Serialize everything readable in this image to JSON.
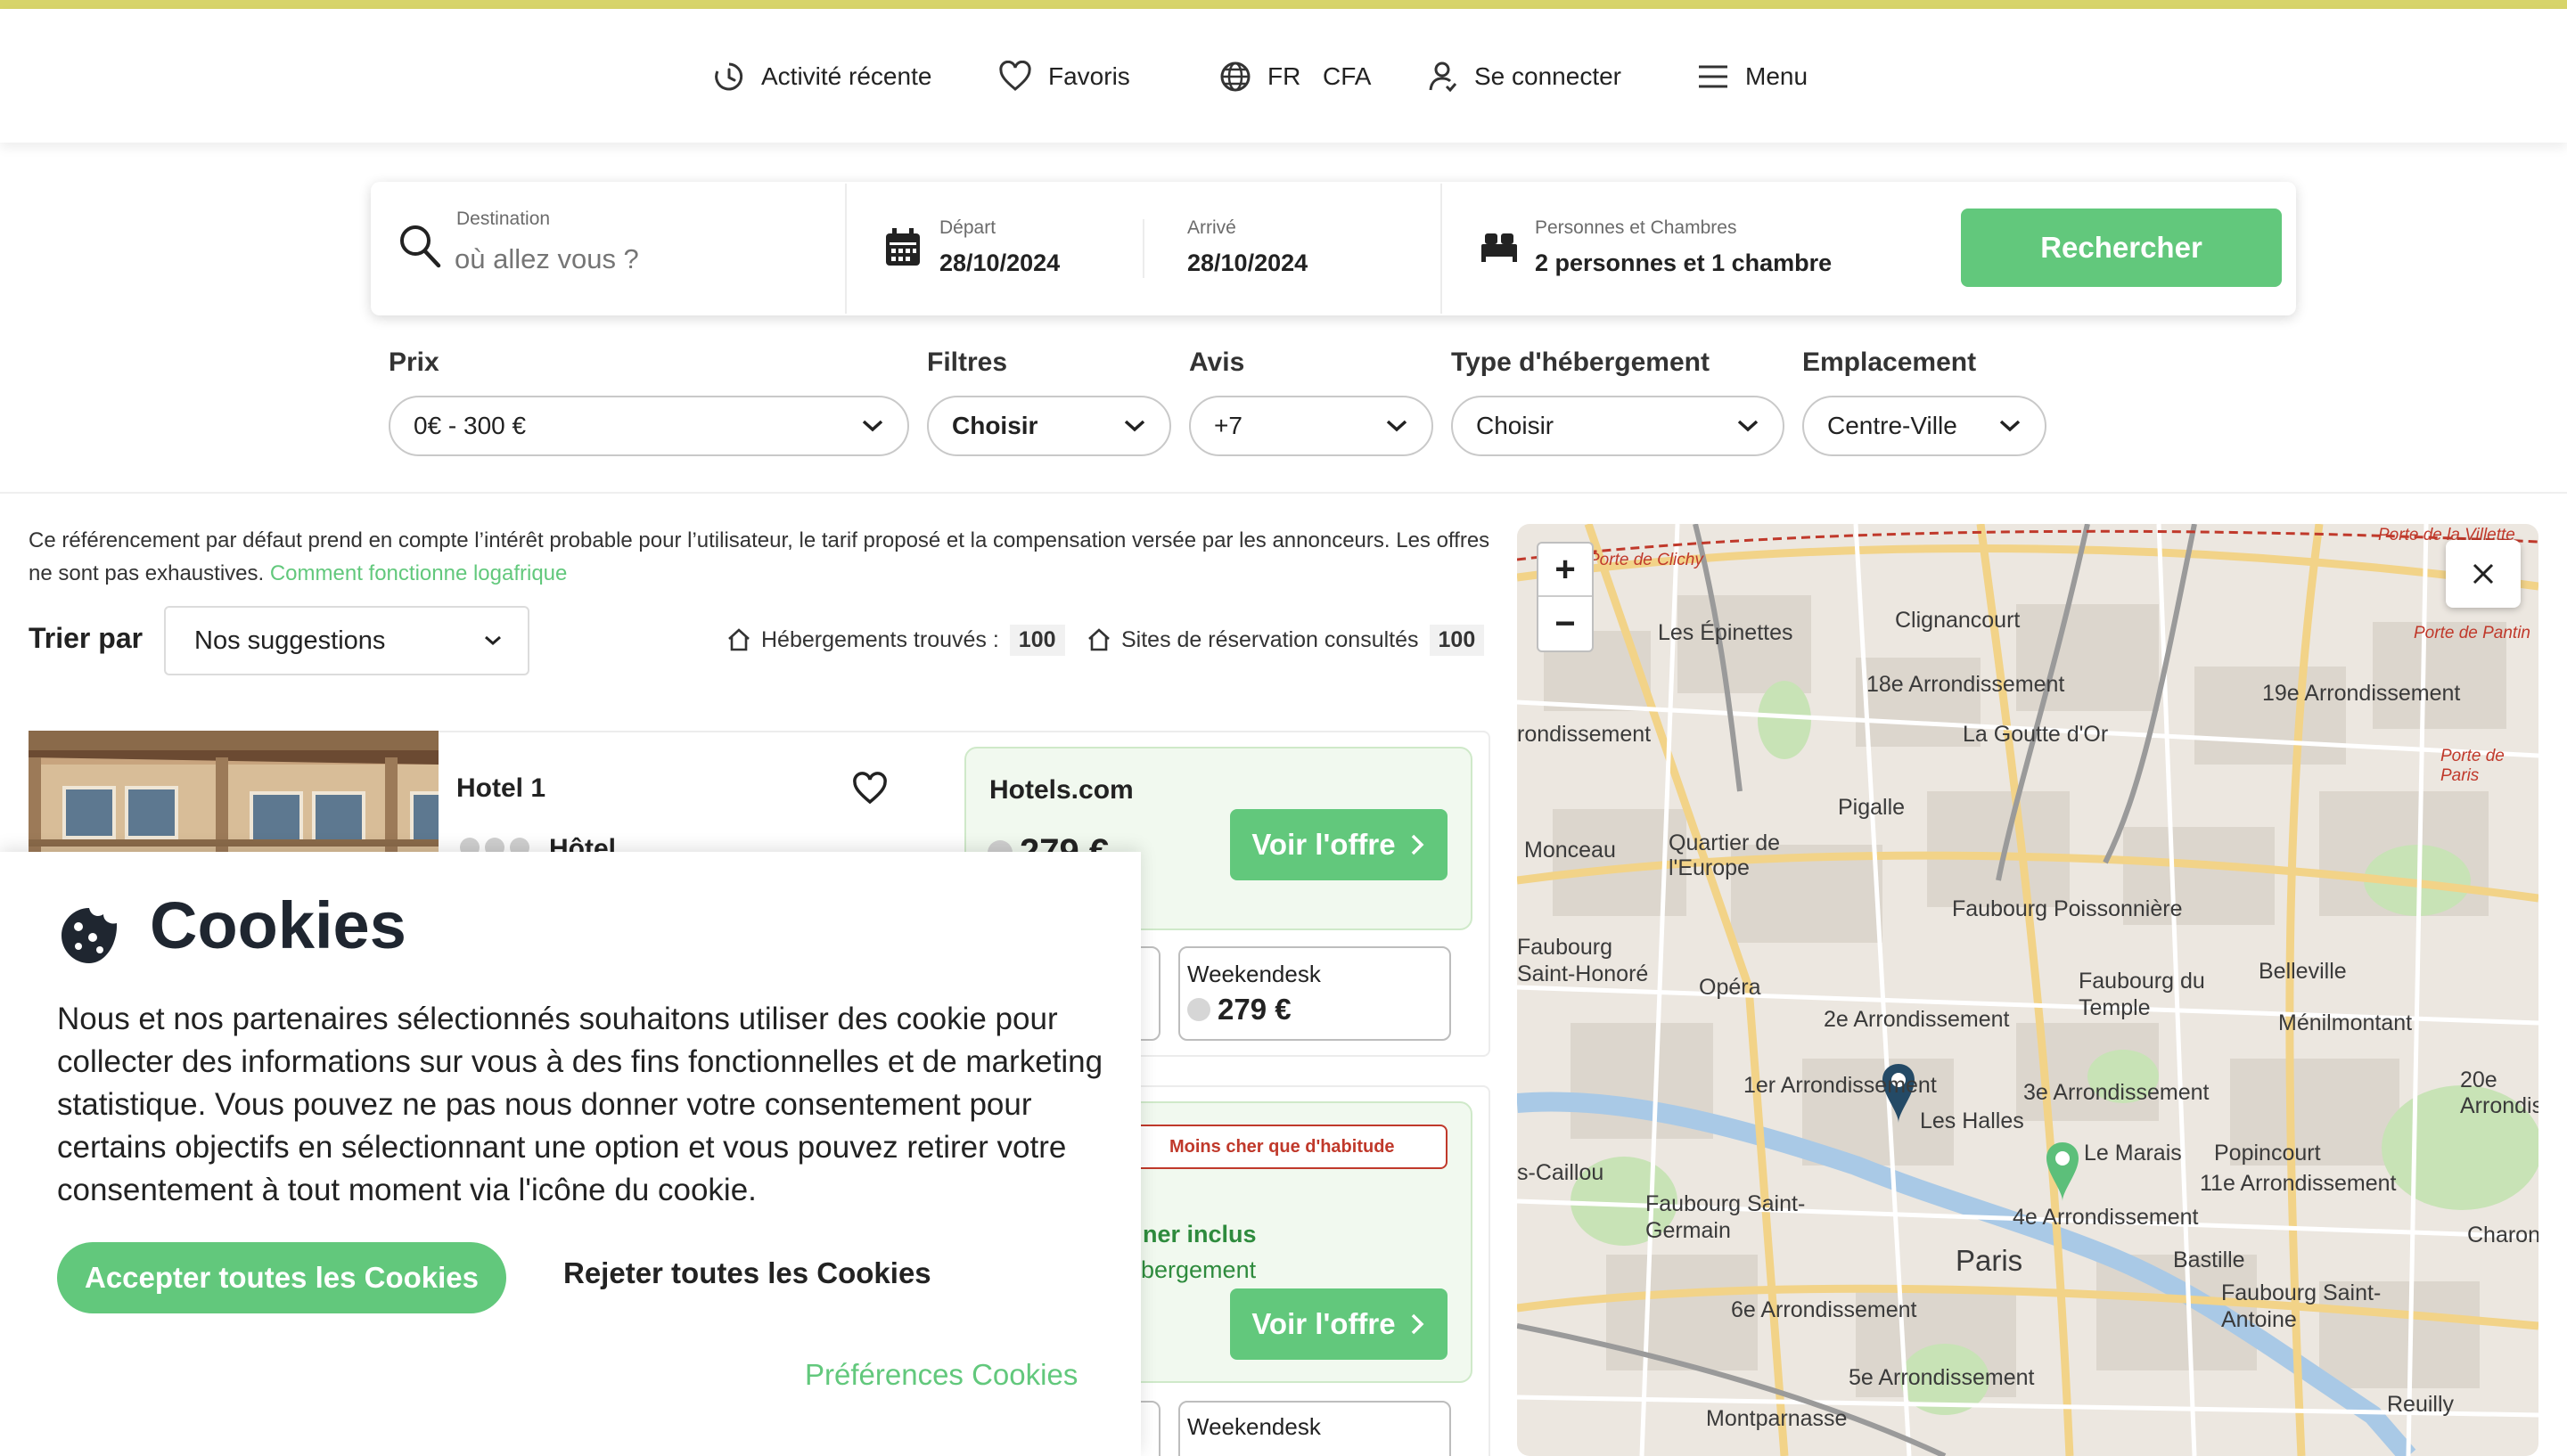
{
  "header": {
    "nav": [
      {
        "label": "Activité récente",
        "icon": "clock-icon"
      },
      {
        "label": "Favoris",
        "icon": "heart-icon"
      },
      {
        "label": "FR",
        "icon": "globe-icon"
      },
      {
        "label": "CFA"
      },
      {
        "label": "Se connecter",
        "icon": "user-icon"
      },
      {
        "label": "Menu",
        "icon": "hamburger-icon"
      }
    ]
  },
  "search": {
    "destination_label": "Destination",
    "destination_placeholder": "où allez vous ?",
    "depart_label": "Départ",
    "depart_value": "28/10/2024",
    "arrive_label": "Arrivé",
    "arrive_value": "28/10/2024",
    "guests_label": "Personnes et Chambres",
    "guests_value": "2 personnes et 1 chambre",
    "submit_label": "Rechercher"
  },
  "filters": [
    {
      "label": "Prix",
      "value": "0€ - 300 €"
    },
    {
      "label": "Filtres",
      "value": "Choisir"
    },
    {
      "label": "Avis",
      "value": "+7"
    },
    {
      "label": "Type d'hébergement",
      "value": "Choisir"
    },
    {
      "label": "Emplacement",
      "value": "Centre-Ville"
    }
  ],
  "results": {
    "disclaimer": "Ce référencement par défaut prend en compte l’intérêt probable pour l’utilisateur, le tarif proposé et la compensation versée par les annonceurs. Les offres ne sont pas exhaustives.",
    "disclaimer_link": "Comment fonctionne logafrique",
    "sort_label": "Trier par",
    "sort_value": "Nos suggestions",
    "found_label": "Hébergements trouvés :",
    "found_count": "100",
    "sites_label": "Sites de réservation consultés",
    "sites_count": "100"
  },
  "hotels": [
    {
      "name": "Hotel 1",
      "type": "Hôtel",
      "offer_site": "Hotels.com",
      "offer_price": "279 €",
      "offer_button": "Voir l'offre",
      "alt_site": "Weekendesk",
      "alt_price": "279 €"
    },
    {
      "badge": "Moins cher que d'habitude",
      "perk": "ner inclus",
      "perk_sub": "bergement",
      "offer_button": "Voir l'offre",
      "alt_site": "Weekendesk"
    }
  ],
  "map": {
    "colors": {
      "pin_dark": "#244a66",
      "pin_green": "#5cbf7a"
    },
    "labels": [
      "Les Épinettes",
      "Clignancourt",
      "18e Arrondissement",
      "19e Arrondissement",
      "La Goutte d'Or",
      "Pigalle",
      "Monceau",
      "Quartier de l'Europe",
      "Faubourg Poissonnière",
      "Faubourg Saint-Honoré",
      "Opéra",
      "2e Arrondissement",
      "Faubourg du Temple",
      "Belleville",
      "Ménilmontant",
      "20e Arrondis",
      "1er Arrondissement",
      "3e Arrondissement",
      "Les Halles",
      "Le Marais",
      "Popincourt",
      "11e Arrondissement",
      "Faubourg Saint-Germain",
      "4e Arrondissement",
      "Paris",
      "Bastille",
      "Charonn",
      "Faubourg Saint-Antoine",
      "6e Arrondissement",
      "5e Arrondissement",
      "Montparnasse",
      "Reuilly",
      "rondissement",
      "s-Caillou",
      "Porte de Clichy",
      "Porte de la Villette",
      "Porte de Pantin",
      "Porte de Paris"
    ]
  },
  "cookies": {
    "title": "Cookies",
    "text": "Nous et nos partenaires sélectionnés souhaitons utiliser des cookie pour collecter des informations sur vous à des fins fonctionnelles et de marketing statistique. Vous pouvez ne pas nous donner votre consentement pour certains objectifs en sélectionnant une option et vous pouvez retirer votre consentement à tout moment via l'icône du cookie.",
    "accept": "Accepter toutes les Cookies",
    "reject": "Rejeter toutes les Cookies",
    "preferences": "Préférences Cookies"
  },
  "accent": "#62c87c"
}
